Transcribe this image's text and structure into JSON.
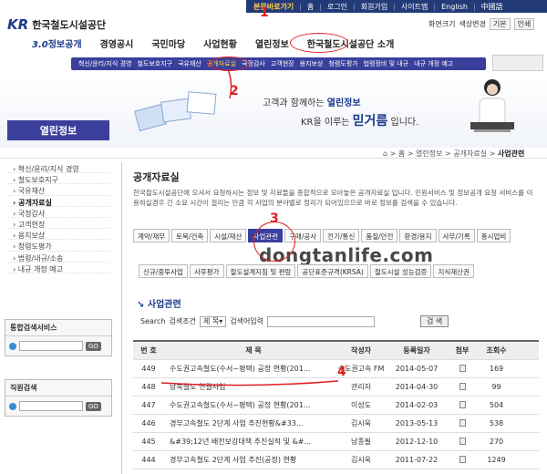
{
  "topbar": {
    "items": [
      "본문바로가기",
      "홈",
      "로그인",
      "회원가입",
      "사이트맵",
      "English",
      "中國語"
    ]
  },
  "header": {
    "logo_mark": "KR",
    "org_name": "한국철도시설공단",
    "quicklinks": [
      "화면크기",
      "색상변경",
      "기본",
      "인쇄"
    ]
  },
  "mainnav": [
    "정보공개",
    "경영공시",
    "국민마당",
    "사업현황",
    "열린정보",
    "한국철도시설공단 소개"
  ],
  "mainnav_logo": "3.0",
  "subnav": [
    "혁신/윤리/지식 경영",
    "철도보호지구",
    "국유재산",
    "공개자료실",
    "국정감사",
    "고객현장",
    "용지보상",
    "청렴도평가",
    "법령정비 및 내규",
    "내규 개정 예고"
  ],
  "banner": {
    "slogan1_pre": "고객과 함께하는 ",
    "slogan1_bold": "열린정보",
    "slogan2_pre": "KR을 이루는 ",
    "slogan2_bold": "믿거름",
    "slogan2_post": " 입니다."
  },
  "left_header": "열린정보",
  "breadcrumb": {
    "items": [
      "홈",
      "열린정보",
      "공개자료실"
    ],
    "current": "사업관련"
  },
  "sidebar": {
    "items": [
      "혁신/윤리/지식 경영",
      "철도보호지구",
      "국유재산",
      "공개자료실",
      "국정감사",
      "고객현장",
      "용지보상",
      "청렴도평가",
      "법령/내규/소송",
      "내규 개정 예고"
    ]
  },
  "unified_search": {
    "title": "통합검색서비스",
    "go": "GO"
  },
  "staff_search": {
    "title": "직원검색",
    "go": "GO"
  },
  "content": {
    "title": "공개자료실",
    "description": "한국철도시설공단에 오셔서 요청하시는 정보 및 자료들을 종합적으로 모아놓은 공개자료실 입니다. 민원서비스 및 정보공개 요청 서비스를 이용하실경우 긴 소요 시간이 걸리는 만큼 각 사업의 분야별로 정리가 되어있으므로 바로 정보를 검색을 수 있습니다."
  },
  "tabs_row1": [
    "계약/재무",
    "토목/건축",
    "시설/재산",
    "사업관련",
    "구매/공사",
    "전기/통신",
    "품질/안전",
    "환경/용지",
    "사무/기록",
    "홍시업비"
  ],
  "tabs_row2": [
    "신규/중투사업",
    "사후평가",
    "철도설계지침 및 편람",
    "공단표준규격(KRSA)",
    "철도시설 성능검증",
    "지식재산권"
  ],
  "watermark": "dongtanlife.com",
  "section_title": "사업관련",
  "search": {
    "label": "Search",
    "condition_label": "검색조건",
    "condition_value": "제 목",
    "keyword_label": "검색어입력",
    "button": "검 색"
  },
  "table": {
    "headers": [
      "번 호",
      "제 목",
      "작성자",
      "등록일자",
      "첨부",
      "조회수"
    ],
    "rows": [
      {
        "no": "449",
        "title": "수도권고속철도(수서~평택) 공정 현황(201...",
        "author": "수도권고속 FM",
        "date": "2014-05-07",
        "views": "169"
      },
      {
        "no": "448",
        "title": "남북철도 연결사업",
        "author": "관리자",
        "date": "2014-04-30",
        "views": "99"
      },
      {
        "no": "447",
        "title": "수도권고속철도(수서~평택) 공정 현황(201...",
        "author": "이성도",
        "date": "2014-02-03",
        "views": "504"
      },
      {
        "no": "446",
        "title": "경부고속철도 2단계 사업 추진현황&#33...",
        "author": "김시욱",
        "date": "2013-05-13",
        "views": "538"
      },
      {
        "no": "445",
        "title": "&#39;12년 배전보강대책 추진실적 및 &#...",
        "author": "남종필",
        "date": "2012-12-10",
        "views": "270"
      },
      {
        "no": "444",
        "title": "경부고속철도 2단계 사업 추진(공정) 현황",
        "author": "김시욱",
        "date": "2011-07-22",
        "views": "1249"
      }
    ]
  },
  "annotations": [
    "1",
    "2",
    "3",
    "4"
  ],
  "colors": {
    "nav_blue": "#3b3f9c",
    "dark_blue": "#233a78",
    "annotation_red": "#e02020"
  }
}
